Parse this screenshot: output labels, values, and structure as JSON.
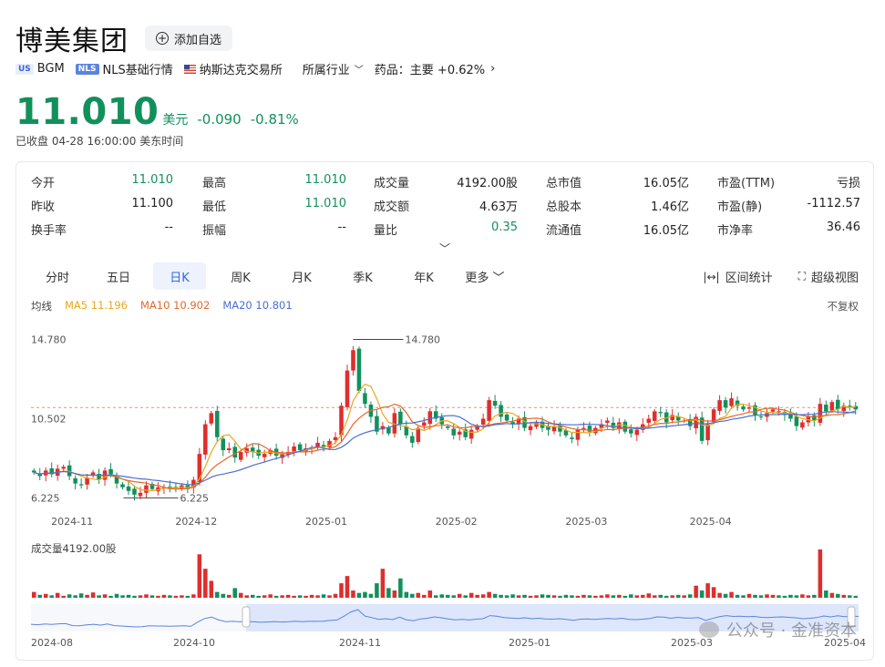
{
  "header": {
    "title": "博美集团",
    "add_fav": "添加自选",
    "market_badge": "US",
    "ticker": "BGM",
    "nls_badge": "NLS",
    "nls_label": "NLS基础行情",
    "exchange": "纳斯达克交易所",
    "industry_menu": "所属行业",
    "sector": "药品：主要 +0.62%"
  },
  "quote": {
    "price": "11.010",
    "unit": "美元",
    "change": "-0.090",
    "change_pct": "-0.81%",
    "status": "已收盘  04-28 16:00:00  美东时间"
  },
  "stats": [
    {
      "label": "今开",
      "value": "11.010",
      "color": "green"
    },
    {
      "label": "最高",
      "value": "11.010",
      "color": "green"
    },
    {
      "label": "成交量",
      "value": "4192.00股"
    },
    {
      "label": "总市值",
      "value": "16.05亿"
    },
    {
      "label": "市盈(TTM)",
      "value": "亏损"
    },
    {
      "label": "昨收",
      "value": "11.100"
    },
    {
      "label": "最低",
      "value": "11.010",
      "color": "green"
    },
    {
      "label": "成交额",
      "value": "4.63万"
    },
    {
      "label": "总股本",
      "value": "1.46亿"
    },
    {
      "label": "市盈(静)",
      "value": "-1112.57"
    },
    {
      "label": "换手率",
      "value": "--"
    },
    {
      "label": "振幅",
      "value": "--"
    },
    {
      "label": "量比",
      "value": "0.35",
      "color": "green"
    },
    {
      "label": "流通值",
      "value": "16.05亿"
    },
    {
      "label": "市净率",
      "value": "36.46"
    }
  ],
  "tabs": [
    "分时",
    "五日",
    "日K",
    "周K",
    "月K",
    "季K",
    "年K",
    "更多"
  ],
  "active_tab": "日K",
  "tools": {
    "range_stats": "区间统计",
    "super_view": "超级视图"
  },
  "ma": {
    "label": "均线",
    "ma5": "MA5 11.196",
    "ma10": "MA10 10.902",
    "ma20": "MA20 10.801",
    "colors": {
      "ma5": "#e8a81c",
      "ma10": "#e2692b",
      "ma20": "#4a6fd2"
    }
  },
  "adjust": "不复权",
  "volume_label": "成交量4192.00股",
  "watermark": "公众号 · 金准资本",
  "colors": {
    "up": "#e02d2d",
    "down": "#12905c"
  },
  "chart_data": {
    "type": "candlestick",
    "y_ticks": [
      "14.780",
      "10.502",
      "6.225"
    ],
    "ylim": [
      6.225,
      14.78
    ],
    "max_annotation": "14.780",
    "min_annotation": "6.225",
    "prev_close_line": 11.1,
    "x_ticks": [
      "2024-11",
      "2024-12",
      "2025-01",
      "2025-02",
      "2025-03",
      "2025-04"
    ],
    "navigator_ticks": [
      "2024-08",
      "2024-10",
      "2024-11",
      "2025-01",
      "2025-03",
      "2025-04"
    ],
    "closes": [
      7.6,
      7.4,
      7.7,
      7.5,
      7.8,
      7.9,
      7.4,
      7.0,
      6.9,
      7.3,
      7.6,
      7.2,
      7.7,
      7.5,
      7.0,
      6.8,
      6.6,
      6.4,
      6.5,
      6.9,
      6.7,
      6.8,
      6.8,
      6.7,
      6.8,
      6.9,
      6.7,
      7.2,
      8.6,
      10.2,
      10.8,
      9.5,
      8.8,
      8.9,
      8.4,
      8.7,
      8.9,
      8.7,
      8.5,
      8.6,
      8.8,
      8.5,
      8.6,
      8.7,
      9.0,
      8.8,
      8.9,
      8.9,
      9.2,
      9.0,
      9.3,
      9.5,
      11.2,
      13.1,
      14.2,
      12.0,
      11.3,
      10.6,
      9.8,
      10.1,
      9.7,
      10.8,
      10.2,
      9.6,
      9.2,
      10.0,
      10.3,
      10.9,
      10.5,
      10.2,
      10.0,
      9.6,
      9.8,
      9.5,
      9.9,
      10.1,
      10.5,
      11.5,
      11.2,
      10.6,
      10.4,
      10.2,
      10.5,
      10.0,
      10.1,
      10.3,
      10.0,
      9.9,
      10.1,
      9.8,
      9.6,
      9.4,
      9.9,
      10.0,
      9.8,
      10.0,
      10.2,
      10.4,
      10.0,
      10.3,
      9.8,
      9.7,
      9.9,
      10.2,
      10.5,
      10.9,
      10.8,
      10.3,
      10.7,
      10.4,
      10.4,
      10.1,
      10.6,
      9.3,
      10.2,
      11.0,
      11.5,
      11.1,
      11.6,
      11.2,
      11.0,
      11.1,
      10.7,
      10.6,
      10.8,
      11.0,
      10.9,
      10.7,
      10.5,
      10.1,
      10.3,
      10.6,
      10.4,
      11.3,
      10.9,
      11.4,
      11.0,
      11.2,
      11.1,
      11.0
    ],
    "volumes": [
      0.12,
      0.06,
      0.08,
      0.05,
      0.1,
      0.04,
      0.07,
      0.05,
      0.09,
      0.06,
      0.11,
      0.05,
      0.07,
      0.04,
      0.08,
      0.05,
      0.06,
      0.04,
      0.05,
      0.07,
      0.05,
      0.04,
      0.06,
      0.05,
      0.04,
      0.05,
      0.04,
      0.07,
      0.9,
      0.6,
      0.35,
      0.12,
      0.08,
      0.06,
      0.2,
      0.1,
      0.05,
      0.06,
      0.04,
      0.05,
      0.07,
      0.04,
      0.05,
      0.06,
      0.04,
      0.05,
      0.04,
      0.06,
      0.05,
      0.07,
      0.05,
      0.08,
      0.3,
      0.45,
      0.15,
      0.1,
      0.12,
      0.08,
      0.3,
      0.6,
      0.2,
      0.15,
      0.4,
      0.12,
      0.08,
      0.1,
      0.06,
      0.15,
      0.05,
      0.07,
      0.06,
      0.05,
      0.08,
      0.05,
      0.1,
      0.06,
      0.07,
      0.12,
      0.08,
      0.06,
      0.05,
      0.07,
      0.05,
      0.06,
      0.04,
      0.05,
      0.07,
      0.06,
      0.05,
      0.04,
      0.06,
      0.05,
      0.04,
      0.06,
      0.05,
      0.04,
      0.05,
      0.07,
      0.05,
      0.06,
      0.04,
      0.07,
      0.05,
      0.06,
      0.09,
      0.05,
      0.06,
      0.04,
      0.05,
      0.06,
      0.05,
      0.07,
      0.25,
      0.15,
      0.3,
      0.22,
      0.1,
      0.08,
      0.12,
      0.06,
      0.05,
      0.08,
      0.06,
      0.05,
      0.07,
      0.06,
      0.05,
      0.04,
      0.06,
      0.05,
      0.07,
      0.05,
      0.06,
      1.0,
      0.15,
      0.1,
      0.08,
      0.06,
      0.05,
      0.04
    ]
  }
}
